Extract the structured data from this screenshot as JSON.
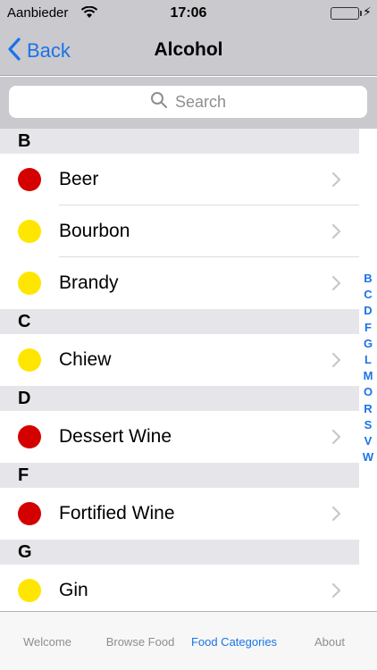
{
  "status_bar": {
    "carrier": "Aanbieder",
    "time": "17:06",
    "battery_level": 1.0
  },
  "nav": {
    "back_label": "Back",
    "title": "Alcohol"
  },
  "search": {
    "placeholder": "Search"
  },
  "colors": {
    "accent": "#1a73e8",
    "status_red": "#d40000",
    "status_yellow": "#ffe600"
  },
  "sections": [
    {
      "letter": "B",
      "items": [
        {
          "label": "Beer",
          "status": "red"
        },
        {
          "label": "Bourbon",
          "status": "yellow"
        },
        {
          "label": "Brandy",
          "status": "yellow"
        }
      ]
    },
    {
      "letter": "C",
      "items": [
        {
          "label": "Chiew",
          "status": "yellow"
        }
      ]
    },
    {
      "letter": "D",
      "items": [
        {
          "label": "Dessert Wine",
          "status": "red"
        }
      ]
    },
    {
      "letter": "F",
      "items": [
        {
          "label": "Fortified Wine",
          "status": "red"
        }
      ]
    },
    {
      "letter": "G",
      "items": [
        {
          "label": "Gin",
          "status": "yellow"
        }
      ]
    }
  ],
  "index_letters": [
    "B",
    "C",
    "D",
    "F",
    "G",
    "L",
    "M",
    "O",
    "R",
    "S",
    "V",
    "W"
  ],
  "tabs": [
    {
      "label": "Welcome",
      "active": false
    },
    {
      "label": "Browse Food",
      "active": false
    },
    {
      "label": "Food Categories",
      "active": true
    },
    {
      "label": "About",
      "active": false
    }
  ]
}
